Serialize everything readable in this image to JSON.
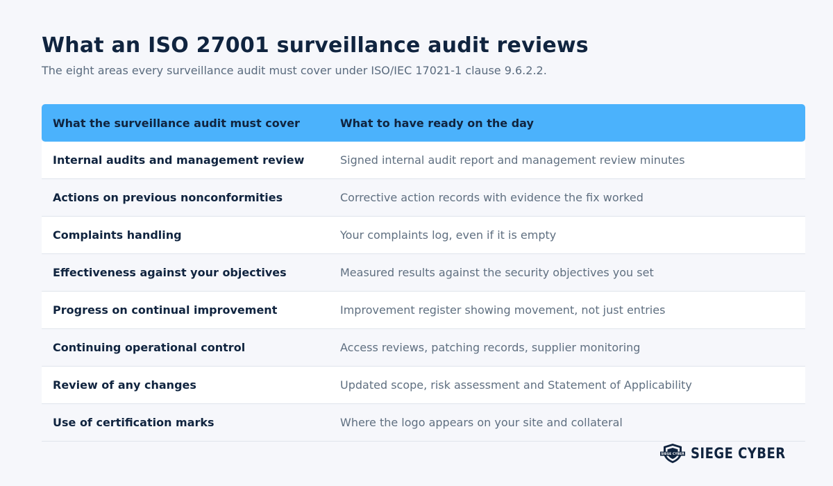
{
  "title": "What an ISO 27001 surveillance audit reviews",
  "subtitle": "The eight areas every surveillance audit must cover under ISO/IEC 17021-1 clause 9.6.2.2.",
  "table": {
    "headers": [
      "What the surveillance audit must cover",
      "What to have ready on the day"
    ],
    "rows": [
      {
        "area": "Internal audits and management review",
        "evidence": "Signed internal audit report and management review minutes"
      },
      {
        "area": "Actions on previous nonconformities",
        "evidence": "Corrective action records with evidence the fix worked"
      },
      {
        "area": "Complaints handling",
        "evidence": "Your complaints log, even if it is empty"
      },
      {
        "area": "Effectiveness against your objectives",
        "evidence": "Measured results against the security objectives you set"
      },
      {
        "area": "Progress on continual improvement",
        "evidence": "Improvement register showing movement, not just entries"
      },
      {
        "area": "Continuing operational control",
        "evidence": "Access reviews, patching records, supplier monitoring"
      },
      {
        "area": "Review of any changes",
        "evidence": "Updated scope, risk assessment and Statement of Applicability"
      },
      {
        "area": "Use of certification marks",
        "evidence": "Where the logo appears on your site and collateral"
      }
    ]
  },
  "brand": {
    "name": "SIEGE CYBER",
    "logo_text": "SIEGE CYBER",
    "logo_icon": "shield-logo-icon"
  },
  "colors": {
    "header_bg": "#4bb2fc",
    "title_text": "#10243f",
    "body_text": "#5f6f80",
    "page_bg": "#f6f7fb"
  }
}
